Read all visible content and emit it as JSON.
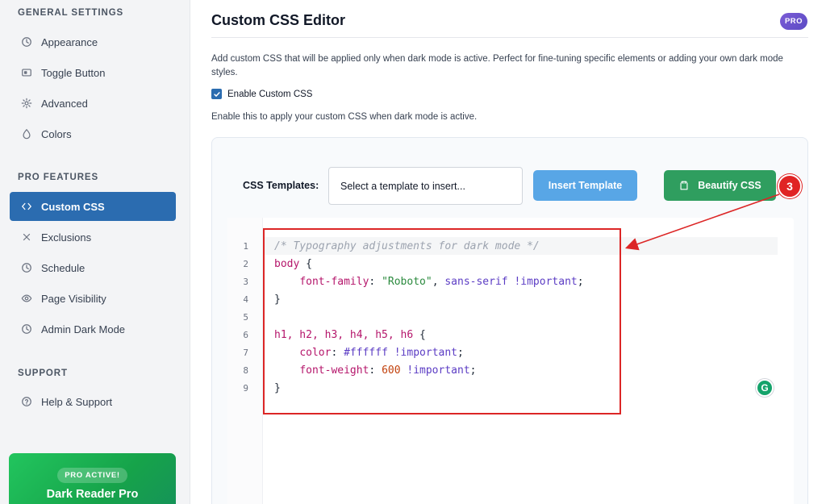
{
  "sidebar": {
    "general_title": "GENERAL SETTINGS",
    "general_items": [
      {
        "label": "Appearance",
        "icon": "clock-icon"
      },
      {
        "label": "Toggle Button",
        "icon": "toggle-icon"
      },
      {
        "label": "Advanced",
        "icon": "gear-icon"
      },
      {
        "label": "Colors",
        "icon": "droplet-icon"
      }
    ],
    "pro_title": "PRO FEATURES",
    "pro_items": [
      {
        "label": "Custom CSS",
        "icon": "code-icon",
        "active": true
      },
      {
        "label": "Exclusions",
        "icon": "x-icon"
      },
      {
        "label": "Schedule",
        "icon": "clock-icon"
      },
      {
        "label": "Page Visibility",
        "icon": "eye-icon"
      },
      {
        "label": "Admin Dark Mode",
        "icon": "clock-icon"
      }
    ],
    "support_title": "SUPPORT",
    "support_items": [
      {
        "label": "Help & Support",
        "icon": "help-circle-icon"
      }
    ],
    "pro_card": {
      "badge": "PRO ACTIVE!",
      "name": "Dark Reader Pro"
    }
  },
  "main": {
    "title": "Custom CSS Editor",
    "pro_pill": "PRO",
    "description": "Add custom CSS that will be applied only when dark mode is active. Perfect for fine-tuning specific elements or adding your own dark mode styles.",
    "enable_label": "Enable Custom CSS",
    "enable_checked": true,
    "enable_help": "Enable this to apply your custom CSS when dark mode is active.",
    "templates_label": "CSS Templates:",
    "template_select_placeholder": "Select a template to insert...",
    "insert_button": "Insert Template",
    "beautify_button": "Beautify CSS",
    "step_badge": "3"
  },
  "editor": {
    "line_numbers": [
      "1",
      "2",
      "3",
      "4",
      "5",
      "6",
      "7",
      "8",
      "9"
    ],
    "lines": {
      "l1_comment": "/* Typography adjustments for dark mode */",
      "l2_selector": "body",
      "l2_brace": " {",
      "l3_prop": "font-family",
      "l3_colon": ": ",
      "l3_str": "\"Roboto\"",
      "l3_comma": ", ",
      "l3_kw": "sans-serif",
      "l3_imp": " !important",
      "l3_semi": ";",
      "l4_brace": "}",
      "l6_selectors": "h1, h2, h3, h4, h5, h6",
      "l6_brace": " {",
      "l7_prop": "color",
      "l7_colon": ": ",
      "l7_val": "#ffffff",
      "l7_imp": " !important",
      "l7_semi": ";",
      "l8_prop": "font-weight",
      "l8_colon": ": ",
      "l8_num": "600",
      "l8_imp": " !important",
      "l8_semi": ";",
      "l9_brace": "}"
    }
  },
  "colors": {
    "active_nav": "#2b6cb0",
    "insert_button": "#58a6e6",
    "beautify_button": "#2f9e5f",
    "annotation_red": "#dc2626",
    "pro_card": "#22c55e"
  }
}
